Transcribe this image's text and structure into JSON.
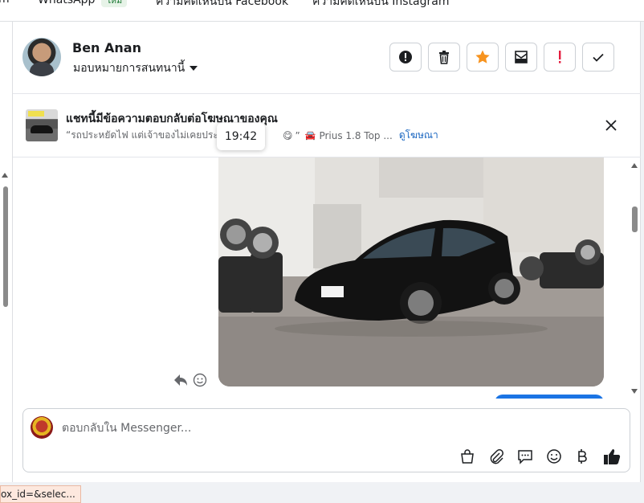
{
  "top_tabs": [
    {
      "label": "m"
    },
    {
      "label": "WhatsApp",
      "badge": "ใหม่"
    },
    {
      "label": "ความคิดเห็นบน Facebook"
    },
    {
      "label": "ความคิดเห็นบน Instagram"
    }
  ],
  "header": {
    "contact_name": "Ben Anan",
    "assign_label": "มอบหมายการสนทนานี้",
    "actions": [
      {
        "name": "spam-report",
        "icon": "alert-circle-icon"
      },
      {
        "name": "delete",
        "icon": "trash-icon"
      },
      {
        "name": "star",
        "icon": "star-icon",
        "color": "#f7931e"
      },
      {
        "name": "mark-unread",
        "icon": "envelope-icon"
      },
      {
        "name": "follow-up",
        "icon": "exclamation-icon",
        "color": "#e41e3f"
      },
      {
        "name": "mark-done",
        "icon": "check-icon"
      }
    ]
  },
  "ad_banner": {
    "title": "แชทนี้มีข้อความตอบกลับต่อโฆษณาของคุณ",
    "quote": "“รถประหยัดไฟ แต่เจ้าของไม่เคยประหยัดความ",
    "quote_end": "”",
    "ad_name": "Prius 1.8 Top ...",
    "link_label": "ดูโฆษณา",
    "tooltip_time": "19:42"
  },
  "composer": {
    "placeholder": "ตอบกลับใน Messenger..."
  },
  "status_url": "ox_id=&selec...",
  "colors": {
    "accent": "#1b74e4",
    "star": "#f7931e",
    "urgent": "#e41e3f"
  }
}
